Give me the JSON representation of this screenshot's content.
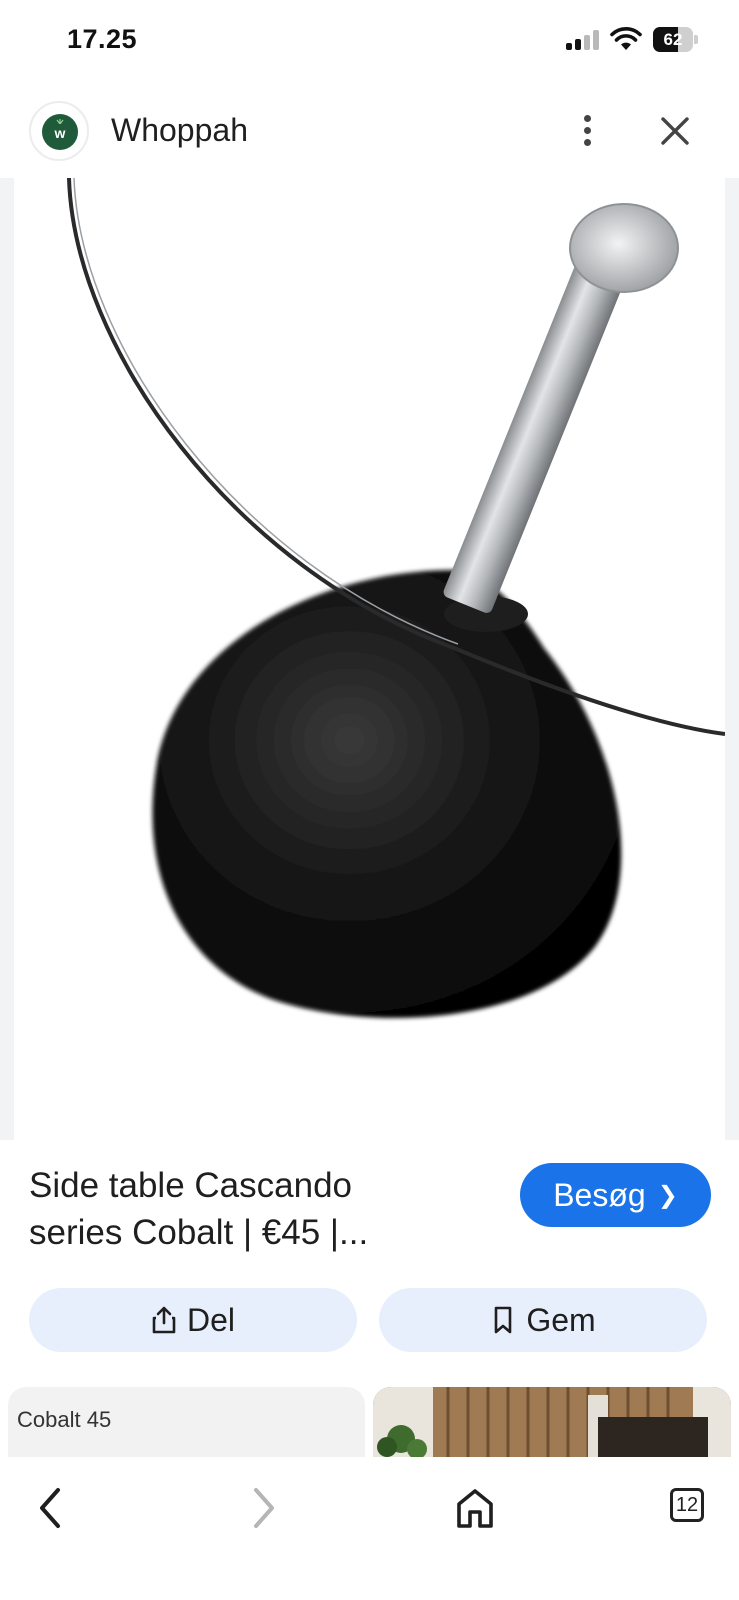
{
  "status_bar": {
    "time": "17.25",
    "battery_percent": "62",
    "battery_level": 0.62
  },
  "header": {
    "site_name": "Whoppah",
    "favicon_letter": "w"
  },
  "result": {
    "title_line1": "Side table Cascando",
    "title_line2": "series Cobalt | €45 |...",
    "visit_label": "Besøg",
    "share_label": "Del",
    "save_label": "Gem"
  },
  "related": {
    "card_left_label": "Cobalt 45"
  },
  "bottom_nav": {
    "tab_count": "12"
  },
  "colors": {
    "accent": "#1a73e8",
    "chip_bg": "#e8effc",
    "favicon_bg": "#1f5a3a"
  },
  "icons": [
    "signal-icon",
    "wifi-icon",
    "battery-icon",
    "more-vert-icon",
    "close-icon",
    "share-icon",
    "bookmark-icon",
    "back-icon",
    "forward-icon",
    "home-icon",
    "tabs-icon"
  ]
}
